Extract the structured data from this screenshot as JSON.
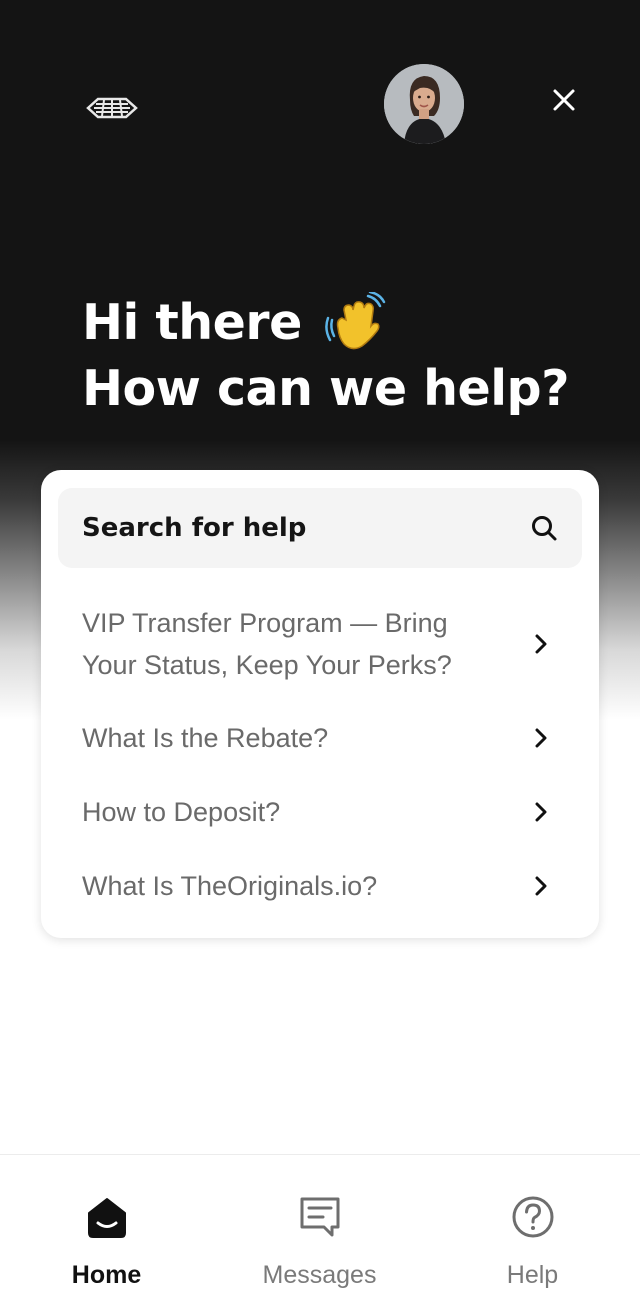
{
  "header": {
    "logo_icon": "brand-logo-icon",
    "avatar_icon": "support-agent-avatar",
    "close_icon": "close-icon"
  },
  "greeting": {
    "line1": "Hi there",
    "line2": "How can we help?",
    "emoji_icon": "waving-hand-icon"
  },
  "search": {
    "label": "Search for help",
    "icon": "search-icon"
  },
  "articles": [
    {
      "title": "VIP Transfer Program — Bring Your Status, Keep Your Perks?"
    },
    {
      "title": "What Is the Rebate?"
    },
    {
      "title": "How to Deposit?"
    },
    {
      "title": "What Is TheOriginals.io?"
    }
  ],
  "tabs": [
    {
      "label": "Home",
      "icon": "home-icon",
      "active": true
    },
    {
      "label": "Messages",
      "icon": "messages-icon",
      "active": false
    },
    {
      "label": "Help",
      "icon": "help-icon",
      "active": false
    }
  ],
  "colors": {
    "hero_background": "#141414",
    "text_primary": "#151515",
    "text_secondary": "#6a6a6a",
    "search_background": "#f4f4f4"
  }
}
